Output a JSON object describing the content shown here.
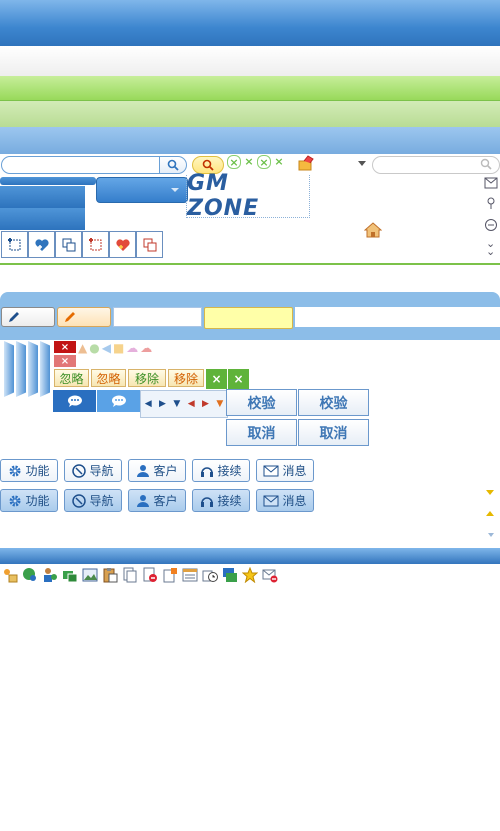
{
  "colors": {
    "header_blue": "#3d86cf",
    "green_band": "#98d95a",
    "panel_blue": "#8cbde8",
    "tag_green": "#3a8f25",
    "tag_orange": "#d25f00",
    "red_x": "#c21414",
    "button_text": "#3f77b5"
  },
  "tags": {
    "ignore_green": "忽略",
    "ignore_orange": "忽略",
    "remove_green": "移除",
    "remove_orange": "移除"
  },
  "actions": {
    "verify1": "校验",
    "verify2": "校验",
    "cancel1": "取消",
    "cancel2": "取消"
  },
  "nav_row1": [
    {
      "icon": "gear-icon",
      "label": "功能"
    },
    {
      "icon": "compass-icon",
      "label": "导航"
    },
    {
      "icon": "user-icon",
      "label": "客户"
    },
    {
      "icon": "headset-icon",
      "label": "接续"
    },
    {
      "icon": "mail-icon",
      "label": "消息"
    }
  ],
  "nav_row2": [
    {
      "icon": "gear-icon",
      "label": "功能"
    },
    {
      "icon": "compass-icon",
      "label": "导航"
    },
    {
      "icon": "user-icon",
      "label": "客户"
    },
    {
      "icon": "headset-icon",
      "label": "接续"
    },
    {
      "icon": "mail-icon",
      "label": "消息"
    }
  ],
  "logo_text": "GM ZONE"
}
